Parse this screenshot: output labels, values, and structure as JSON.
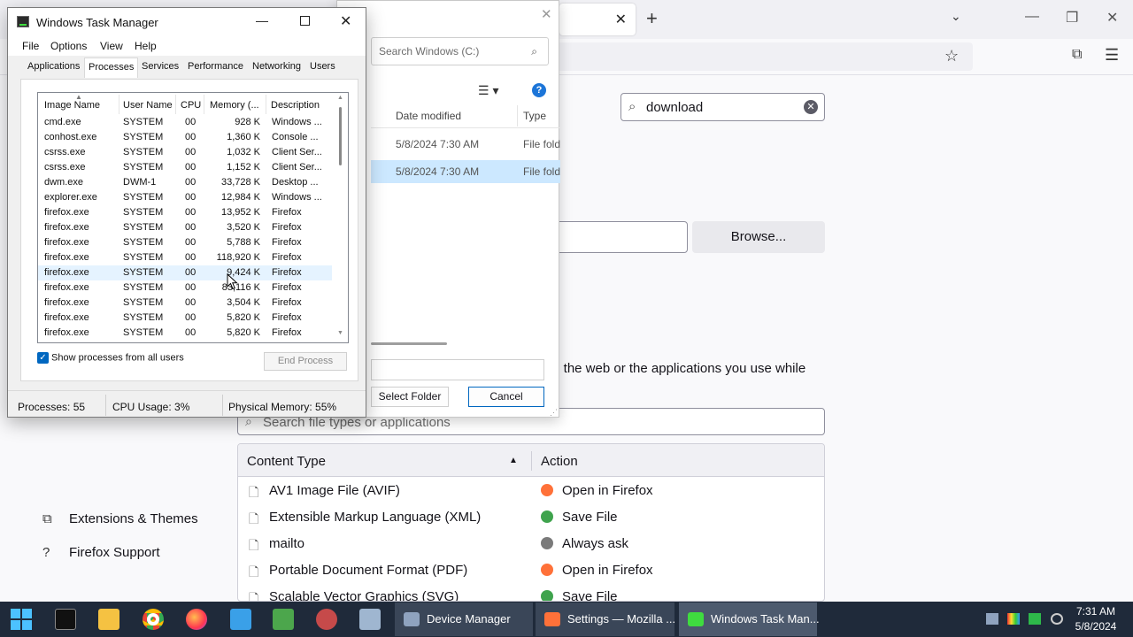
{
  "firefox": {
    "search_value": "download",
    "browse_label": "Browse...",
    "apps_desc": "m the web or the applications you use while",
    "type_search_placeholder": "Search file types or applications",
    "table": {
      "col_content_type": "Content Type",
      "col_action": "Action",
      "rows": [
        {
          "type": "AV1 Image File (AVIF)",
          "action": "Open in Firefox",
          "action_icon": "firefox-icon"
        },
        {
          "type": "Extensible Markup Language (XML)",
          "action": "Save File",
          "action_icon": "save-icon"
        },
        {
          "type": "mailto",
          "action": "Always ask",
          "action_icon": "ask-icon"
        },
        {
          "type": "Portable Document Format (PDF)",
          "action": "Open in Firefox",
          "action_icon": "firefox-icon"
        },
        {
          "type": "Scalable Vector Graphics (SVG)",
          "action": "Save File",
          "action_icon": "save-icon"
        }
      ]
    },
    "sidebar": {
      "extensions": "Extensions & Themes",
      "support": "Firefox Support"
    }
  },
  "dialog": {
    "search_placeholder": "Search Windows (C:)",
    "col_date": "Date modified",
    "col_type": "Type",
    "rows": [
      {
        "date": "5/8/2024 7:30 AM",
        "type": "File fold",
        "selected": false
      },
      {
        "date": "5/8/2024 7:30 AM",
        "type": "File fold",
        "selected": true
      }
    ],
    "select_label": "Select Folder",
    "cancel_label": "Cancel"
  },
  "taskmgr": {
    "title": "Windows Task Manager",
    "menu": [
      "File",
      "Options",
      "View",
      "Help"
    ],
    "tabs": [
      "Applications",
      "Processes",
      "Services",
      "Performance",
      "Networking",
      "Users"
    ],
    "active_tab": "Processes",
    "columns": [
      "Image Name",
      "User Name",
      "CPU",
      "Memory (...",
      "Description"
    ],
    "processes": [
      {
        "image": "cmd.exe",
        "user": "SYSTEM",
        "cpu": "00",
        "mem": "928 K",
        "desc": "Windows ..."
      },
      {
        "image": "conhost.exe",
        "user": "SYSTEM",
        "cpu": "00",
        "mem": "1,360 K",
        "desc": "Console ..."
      },
      {
        "image": "csrss.exe",
        "user": "SYSTEM",
        "cpu": "00",
        "mem": "1,032 K",
        "desc": "Client Ser..."
      },
      {
        "image": "csrss.exe",
        "user": "SYSTEM",
        "cpu": "00",
        "mem": "1,152 K",
        "desc": "Client Ser..."
      },
      {
        "image": "dwm.exe",
        "user": "DWM-1",
        "cpu": "00",
        "mem": "33,728 K",
        "desc": "Desktop ..."
      },
      {
        "image": "explorer.exe",
        "user": "SYSTEM",
        "cpu": "00",
        "mem": "12,984 K",
        "desc": "Windows ..."
      },
      {
        "image": "firefox.exe",
        "user": "SYSTEM",
        "cpu": "00",
        "mem": "13,952 K",
        "desc": "Firefox"
      },
      {
        "image": "firefox.exe",
        "user": "SYSTEM",
        "cpu": "00",
        "mem": "3,520 K",
        "desc": "Firefox"
      },
      {
        "image": "firefox.exe",
        "user": "SYSTEM",
        "cpu": "00",
        "mem": "5,788 K",
        "desc": "Firefox"
      },
      {
        "image": "firefox.exe",
        "user": "SYSTEM",
        "cpu": "00",
        "mem": "118,920 K",
        "desc": "Firefox"
      },
      {
        "image": "firefox.exe",
        "user": "SYSTEM",
        "cpu": "00",
        "mem": "9,424 K",
        "desc": "Firefox"
      },
      {
        "image": "firefox.exe",
        "user": "SYSTEM",
        "cpu": "00",
        "mem": "83,116 K",
        "desc": "Firefox"
      },
      {
        "image": "firefox.exe",
        "user": "SYSTEM",
        "cpu": "00",
        "mem": "3,504 K",
        "desc": "Firefox"
      },
      {
        "image": "firefox.exe",
        "user": "SYSTEM",
        "cpu": "00",
        "mem": "5,820 K",
        "desc": "Firefox"
      },
      {
        "image": "firefox.exe",
        "user": "SYSTEM",
        "cpu": "00",
        "mem": "5,820 K",
        "desc": "Firefox"
      }
    ],
    "hovered_row": 10,
    "show_all_label": "Show processes from all users",
    "show_all_checked": true,
    "end_process_label": "End Process",
    "status": {
      "processes": "Processes: 55",
      "cpu": "CPU Usage: 3%",
      "memory": "Physical Memory: 55%"
    }
  },
  "taskbar": {
    "buttons": [
      {
        "label": "Device Manager",
        "icon": "device-manager-icon",
        "active": false
      },
      {
        "label": "Settings — Mozilla ...",
        "icon": "firefox-icon",
        "active": false
      },
      {
        "label": "Windows Task Man...",
        "icon": "task-manager-icon",
        "active": true
      }
    ],
    "time": "7:31 AM",
    "date": "5/8/2024"
  },
  "colors": {
    "accent": "#0067c0",
    "selection": "#cce8ff",
    "taskbar": "#1f2a3a"
  }
}
